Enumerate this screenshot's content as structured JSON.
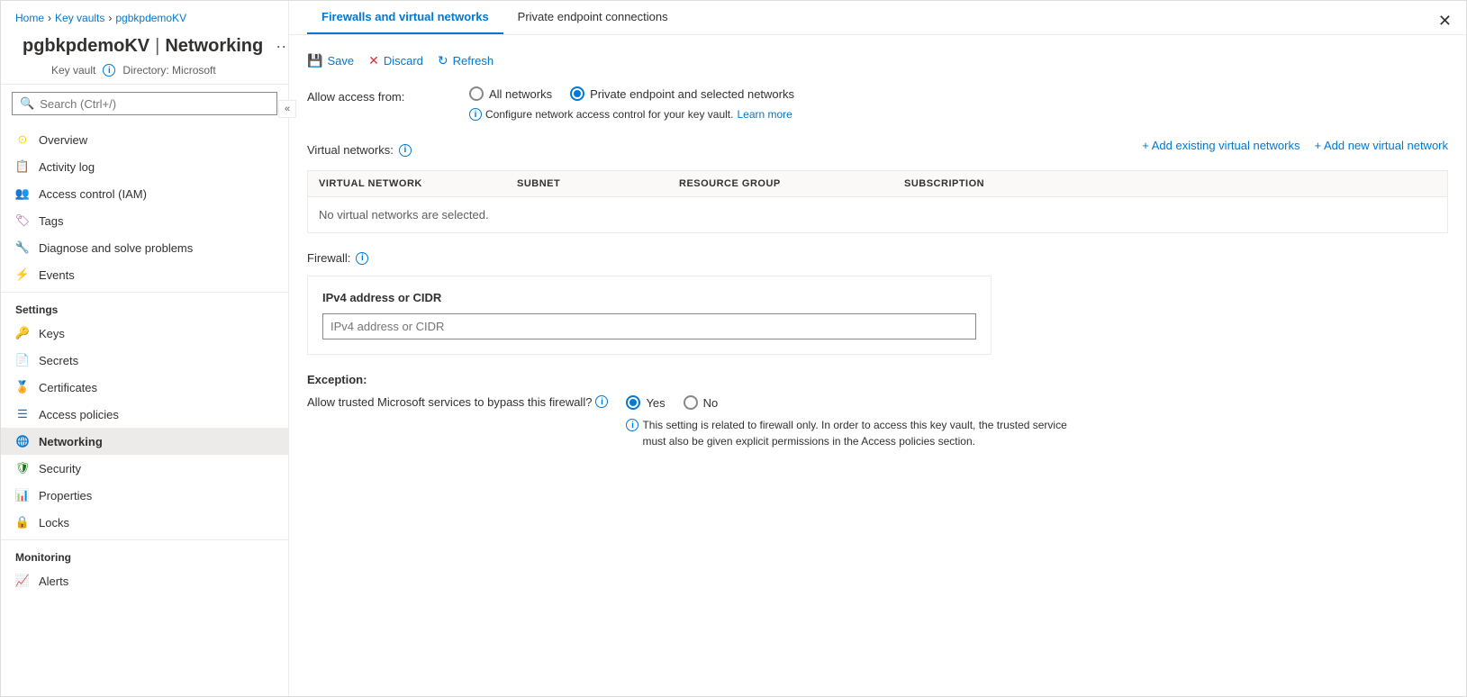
{
  "breadcrumb": {
    "home": "Home",
    "keyVaults": "Key vaults",
    "resource": "pgbkpdemoKV"
  },
  "resource": {
    "name": "pgbkpdemoKV",
    "type": "Key vault",
    "directory": "Directory: Microsoft",
    "pageTitle": "Networking"
  },
  "search": {
    "placeholder": "Search (Ctrl+/)"
  },
  "sidebar": {
    "general": [
      {
        "id": "overview",
        "label": "Overview",
        "icon": "overview"
      },
      {
        "id": "activity-log",
        "label": "Activity log",
        "icon": "activity"
      },
      {
        "id": "access-control",
        "label": "Access control (IAM)",
        "icon": "access-control"
      },
      {
        "id": "tags",
        "label": "Tags",
        "icon": "tags"
      },
      {
        "id": "diagnose",
        "label": "Diagnose and solve problems",
        "icon": "diagnose"
      },
      {
        "id": "events",
        "label": "Events",
        "icon": "events"
      }
    ],
    "settings_label": "Settings",
    "settings": [
      {
        "id": "keys",
        "label": "Keys",
        "icon": "keys"
      },
      {
        "id": "secrets",
        "label": "Secrets",
        "icon": "secrets"
      },
      {
        "id": "certificates",
        "label": "Certificates",
        "icon": "certificates"
      },
      {
        "id": "access-policies",
        "label": "Access policies",
        "icon": "access-policies"
      },
      {
        "id": "networking",
        "label": "Networking",
        "icon": "networking",
        "active": true
      },
      {
        "id": "security",
        "label": "Security",
        "icon": "security"
      },
      {
        "id": "properties",
        "label": "Properties",
        "icon": "properties"
      },
      {
        "id": "locks",
        "label": "Locks",
        "icon": "locks"
      }
    ],
    "monitoring_label": "Monitoring",
    "monitoring": [
      {
        "id": "alerts",
        "label": "Alerts",
        "icon": "alerts"
      }
    ]
  },
  "tabs": [
    {
      "id": "firewalls",
      "label": "Firewalls and virtual networks",
      "active": true
    },
    {
      "id": "private-endpoints",
      "label": "Private endpoint connections",
      "active": false
    }
  ],
  "toolbar": {
    "save": "Save",
    "discard": "Discard",
    "refresh": "Refresh"
  },
  "form": {
    "allow_access_label": "Allow access from:",
    "all_networks_label": "All networks",
    "private_endpoint_label": "Private endpoint and selected networks",
    "info_text": "Configure network access control for your key vault.",
    "learn_more": "Learn more",
    "virtual_networks_label": "Virtual networks:",
    "add_existing": "+ Add existing virtual networks",
    "add_new": "+ Add new virtual network",
    "table_headers": [
      "VIRTUAL NETWORK",
      "SUBNET",
      "RESOURCE GROUP",
      "SUBSCRIPTION"
    ],
    "no_networks": "No virtual networks are selected.",
    "firewall_label": "Firewall:",
    "ipv4_title": "IPv4 address or CIDR",
    "ipv4_placeholder": "IPv4 address or CIDR",
    "exception_label": "Exception:",
    "bypass_label": "Allow trusted Microsoft services to bypass this firewall?",
    "yes": "Yes",
    "no": "No",
    "exception_info": "This setting is related to firewall only. In order to access this key vault, the trusted service must also be given explicit permissions in the Access policies section."
  }
}
